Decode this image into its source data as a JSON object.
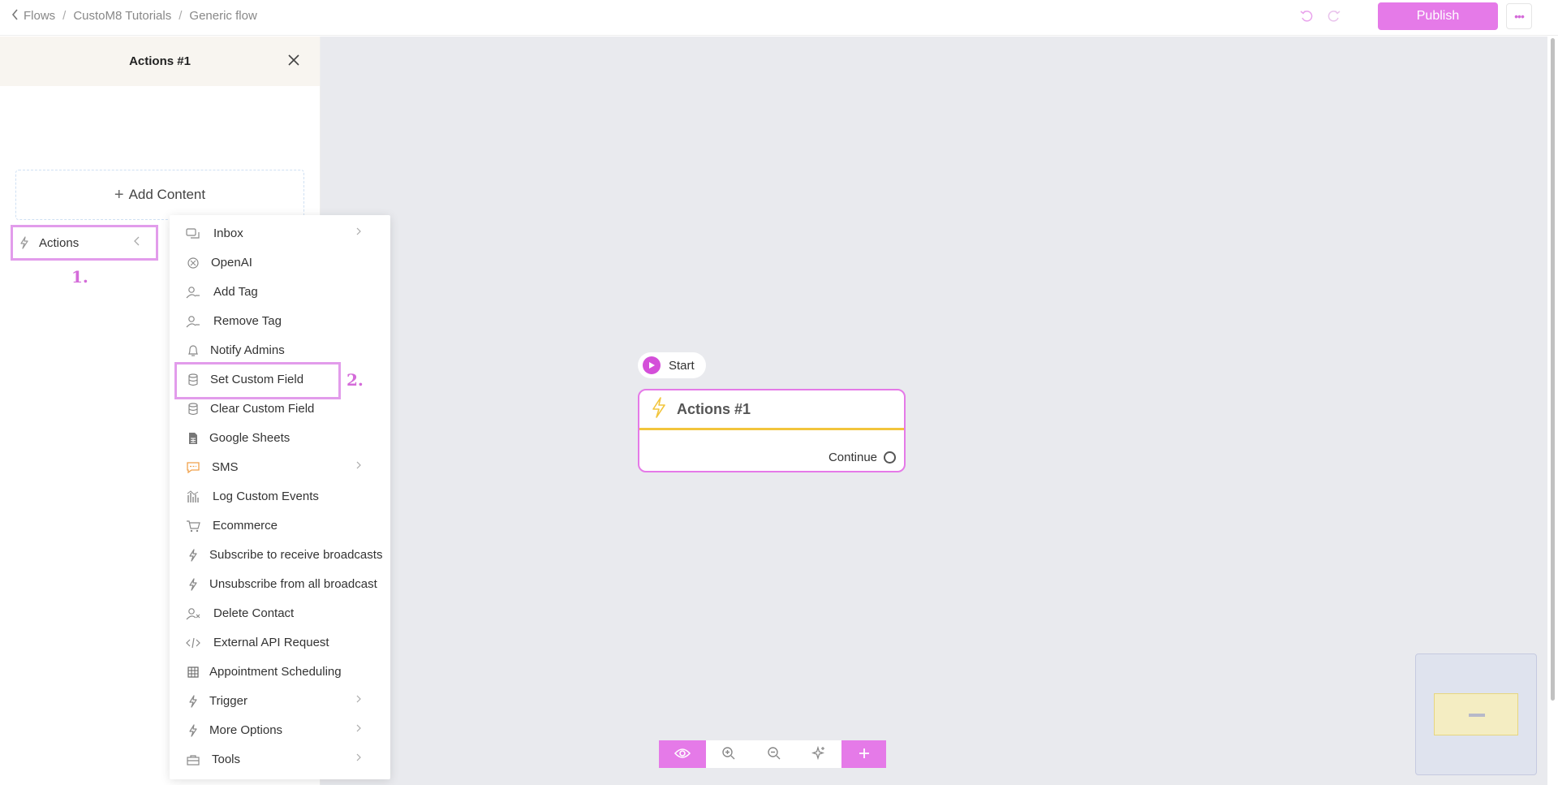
{
  "breadcrumb": {
    "items": [
      "Flows",
      "CustoM8 Tutorials",
      "Generic flow"
    ]
  },
  "header": {
    "publish_label": "Publish"
  },
  "sidebar": {
    "title": "Actions #1",
    "add_content_label": "Add Content",
    "actions_label": "Actions"
  },
  "annotations": {
    "step1": "1.",
    "step2": "2."
  },
  "menu": {
    "items": [
      {
        "label": "Inbox",
        "icon": "inbox-icon",
        "submenu": true
      },
      {
        "label": "OpenAI",
        "icon": "openai-icon",
        "submenu": false
      },
      {
        "label": "Add Tag",
        "icon": "add-tag-icon",
        "submenu": false
      },
      {
        "label": "Remove Tag",
        "icon": "remove-tag-icon",
        "submenu": false
      },
      {
        "label": "Notify Admins",
        "icon": "bell-icon",
        "submenu": false
      },
      {
        "label": "Set Custom Field",
        "icon": "database-icon",
        "submenu": false
      },
      {
        "label": "Clear Custom Field",
        "icon": "database-icon",
        "submenu": false
      },
      {
        "label": "Google Sheets",
        "icon": "sheets-icon",
        "submenu": false
      },
      {
        "label": "SMS",
        "icon": "sms-icon",
        "submenu": true
      },
      {
        "label": "Log Custom Events",
        "icon": "chart-icon",
        "submenu": false
      },
      {
        "label": "Ecommerce",
        "icon": "cart-icon",
        "submenu": false
      },
      {
        "label": "Subscribe to receive broadcasts",
        "icon": "bolt-icon",
        "submenu": false
      },
      {
        "label": "Unsubscribe from all broadcast",
        "icon": "bolt-icon",
        "submenu": false
      },
      {
        "label": "Delete Contact",
        "icon": "delete-user-icon",
        "submenu": false
      },
      {
        "label": "External API Request",
        "icon": "code-icon",
        "submenu": false
      },
      {
        "label": "Appointment Scheduling",
        "icon": "calendar-icon",
        "submenu": false
      },
      {
        "label": "Trigger",
        "icon": "bolt-icon",
        "submenu": true
      },
      {
        "label": "More Options",
        "icon": "bolt-icon",
        "submenu": true
      },
      {
        "label": "Tools",
        "icon": "toolbox-icon",
        "submenu": true
      }
    ]
  },
  "canvas": {
    "start_label": "Start",
    "node_title": "Actions #1",
    "continue_label": "Continue"
  },
  "colors": {
    "accent": "#e57ae8",
    "node_border": "#e57ae8",
    "node_divider": "#f2c53d",
    "canvas_bg": "#e9eaee"
  }
}
